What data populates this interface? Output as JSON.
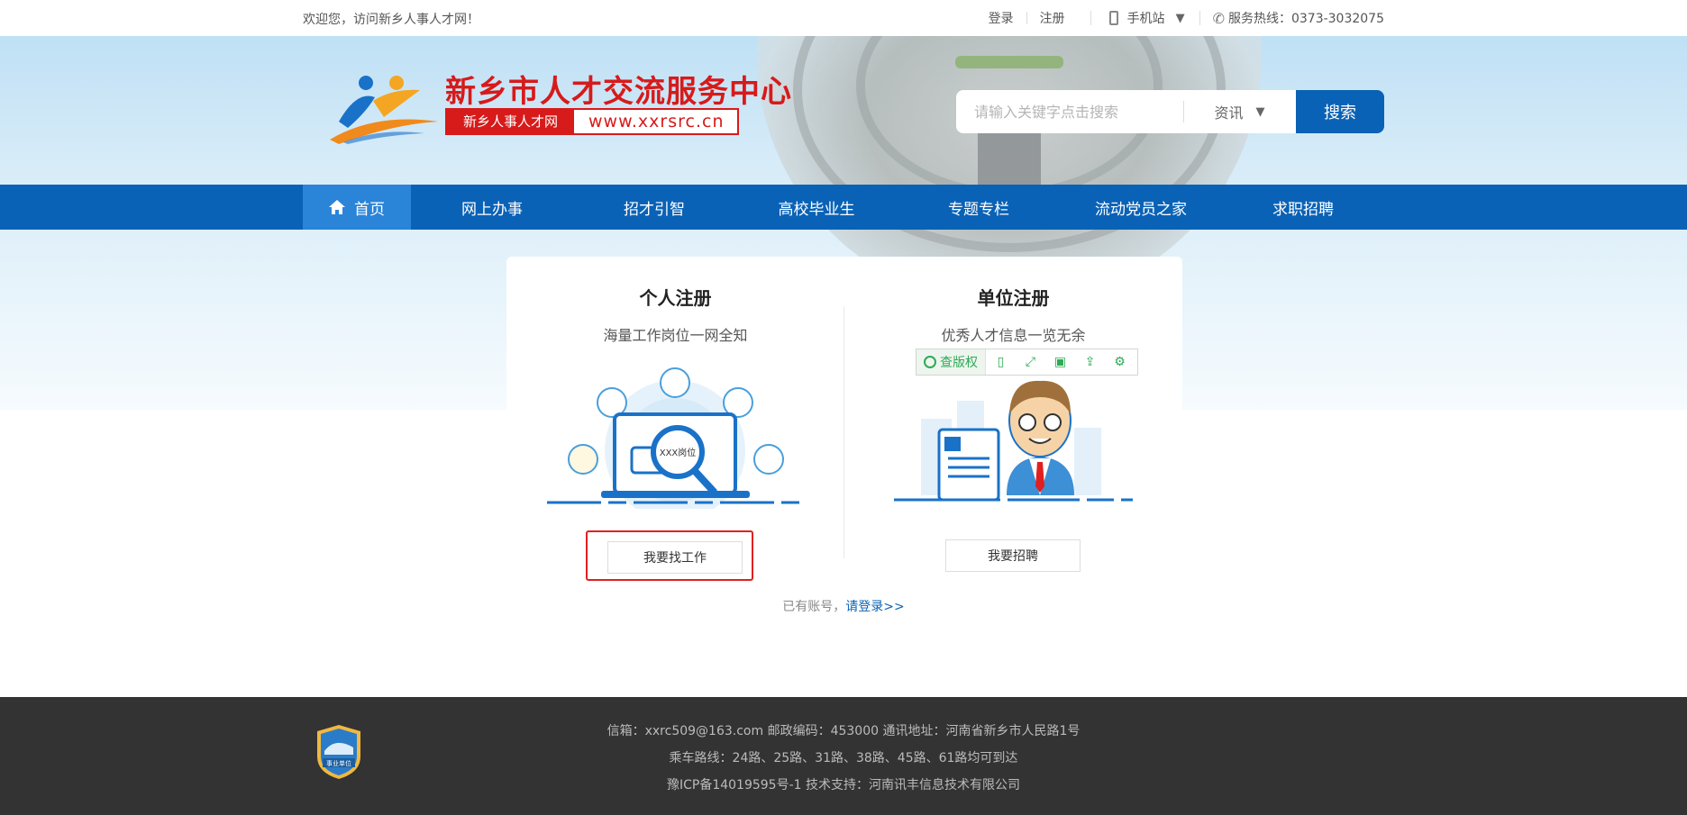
{
  "topbar": {
    "welcome": "欢迎您，访问新乡人事人才网！",
    "login": "登录",
    "register": "注册",
    "mobile_site": "手机站",
    "hotline": "服务热线：0373-3032075"
  },
  "header": {
    "title": "新乡市人才交流服务中心",
    "subtitle_left": "新乡人事人才网",
    "subtitle_right": "www.xxrsrc.cn"
  },
  "search": {
    "placeholder": "请输入关键字点击搜索",
    "category": "资讯",
    "button": "搜索"
  },
  "nav": {
    "items": [
      {
        "label": "首页"
      },
      {
        "label": "网上办事"
      },
      {
        "label": "招才引智"
      },
      {
        "label": "高校毕业生"
      },
      {
        "label": "专题专栏"
      },
      {
        "label": "流动党员之家"
      },
      {
        "label": "求职招聘"
      }
    ]
  },
  "register": {
    "personal": {
      "title": "个人注册",
      "subtitle": "海量工作岗位一网全知",
      "illustration_text": "XXX岗位",
      "button": "我要找工作"
    },
    "company": {
      "title": "单位注册",
      "subtitle": "优秀人才信息一览无余",
      "button": "我要招聘"
    },
    "login_prompt": "已有账号，",
    "login_link": "请登录>>"
  },
  "toolbar": {
    "copyright_label": "查版权"
  },
  "footer": {
    "line1": "信箱：xxrc509@163.com 邮政编码：453000 通讯地址：河南省新乡市人民路1号",
    "line2": "乘车路线：24路、25路、31路、38路、45路、61路均可到达",
    "line3": "豫ICP备14019595号-1 技术支持：河南讯丰信息技术有限公司",
    "badge_text": "事业单位"
  },
  "colors": {
    "primary": "#0a62b6",
    "title_red": "#d71a1a",
    "footer_bg": "#333333",
    "toolbar_green": "#2eaa55"
  }
}
